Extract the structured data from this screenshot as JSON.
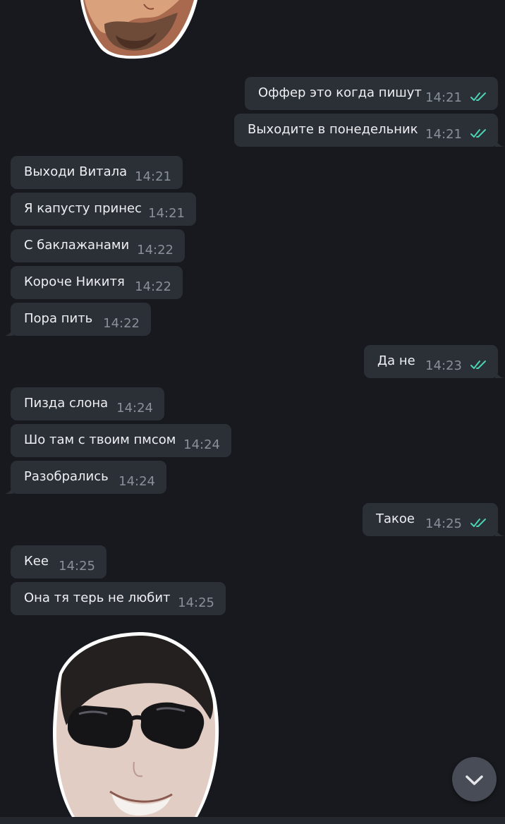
{
  "colors": {
    "background": "#17191e",
    "bubble": "#2b2f36",
    "text": "#eef0f3",
    "timestamp": "#8a9099",
    "read_check": "#4bd3b4",
    "scroll_button": "#474c56"
  },
  "messages": [
    {
      "direction": "outgoing",
      "text": "Оффер это когда пишут",
      "time": "14:21",
      "status_icon": "double-check-icon"
    },
    {
      "direction": "outgoing",
      "text": "Выходите в понедельник",
      "time": "14:21",
      "status_icon": "double-check-icon"
    },
    {
      "direction": "incoming",
      "text": "Выходи Витала",
      "time": "14:21"
    },
    {
      "direction": "incoming",
      "text": "Я капусту принес",
      "time": "14:21"
    },
    {
      "direction": "incoming",
      "text": "С баклажанами",
      "time": "14:22"
    },
    {
      "direction": "incoming",
      "text": "Короче Никитя",
      "time": "14:22"
    },
    {
      "direction": "incoming",
      "text": "Пора пить",
      "time": "14:22"
    },
    {
      "direction": "outgoing",
      "text": "Да не",
      "time": "14:23",
      "status_icon": "double-check-icon"
    },
    {
      "direction": "incoming",
      "text": "Пизда слона",
      "time": "14:24"
    },
    {
      "direction": "incoming",
      "text": "Шо там с твоим пмсом",
      "time": "14:24"
    },
    {
      "direction": "incoming",
      "text": "Разобрались",
      "time": "14:24"
    },
    {
      "direction": "outgoing",
      "text": "Такое",
      "time": "14:25",
      "status_icon": "double-check-icon"
    },
    {
      "direction": "incoming",
      "text": "Кее",
      "time": "14:25"
    },
    {
      "direction": "incoming",
      "text": "Она тя терь не любит",
      "time": "14:25"
    }
  ],
  "stickers": [
    "face-sticker-bearded",
    "face-sticker-sunglasses"
  ],
  "scroll_button_icon": "chevron-down-icon"
}
